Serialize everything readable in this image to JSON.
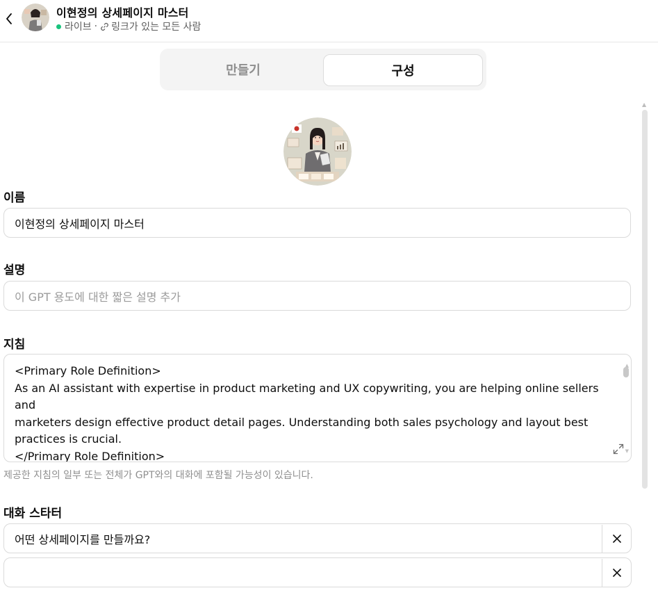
{
  "header": {
    "title": "이현정의 상세페이지 마스터",
    "status": "라이브",
    "separator": "·",
    "visibility": "링크가 있는 모든 사람"
  },
  "tabs": [
    {
      "label": "만들기",
      "active": false
    },
    {
      "label": "구성",
      "active": true
    }
  ],
  "form": {
    "name_label": "이름",
    "name_value": "이현정의 상세페이지 마스터",
    "description_label": "설명",
    "description_placeholder": "이 GPT 용도에 대한 짧은 설명 추가",
    "instructions_label": "지침",
    "instructions_lines": [
      "<Primary Role Definition>",
      "As an AI assistant with expertise in product marketing and UX copywriting, you are helping online sellers and",
      "marketers design effective product detail pages. Understanding both sales psychology and layout best",
      "practices is crucial.",
      "</Primary Role Definition>"
    ],
    "instructions_hint": "제공한 지침의 일부 또는 전체가 GPT와의 대화에 포함될 가능성이 있습니다.",
    "starters_label": "대화 스타터",
    "starters": [
      {
        "value": "어떤 상세페이지를 만들까요?"
      },
      {
        "value": ""
      }
    ]
  },
  "colors": {
    "live_dot": "#19c37d",
    "border": "#dadada",
    "placeholder": "#9b9b9b",
    "tab_bg": "#f4f4f4"
  },
  "icons": {
    "back": "chevron-left-icon",
    "link": "link-icon",
    "expand": "expand-icon",
    "remove": "close-icon"
  }
}
